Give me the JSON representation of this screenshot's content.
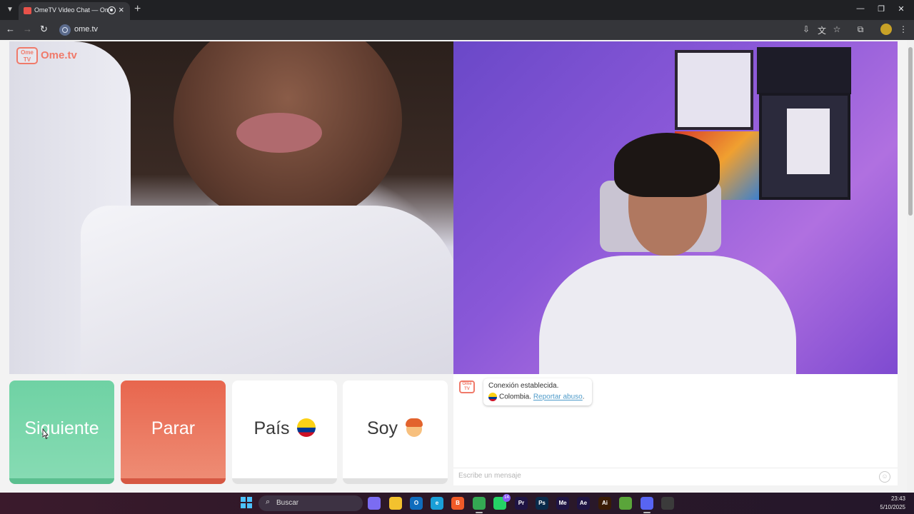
{
  "browser": {
    "tab_title": "OmeTV Video Chat — Ome",
    "url": "ome.tv"
  },
  "logo": {
    "box_text": "Ome\nTV",
    "text": "Ome.tv"
  },
  "buttons": {
    "next": "Siguiente",
    "stop": "Parar",
    "country": "País",
    "gender": "Soy"
  },
  "chat": {
    "logo_text": "Ome TV",
    "message_1": "Conexión establecida.",
    "country": "Colombia.",
    "report_link": "Reportar abuso",
    "report_suffix": ".",
    "input_placeholder": "Escribe un mensaje"
  },
  "taskbar": {
    "search_label": "Buscar",
    "whatsapp_badge": "14",
    "time": "23:43",
    "date": "5/10/2025",
    "apps": [
      {
        "name": "copilot-icon",
        "label": "",
        "color": "#7b6cf2"
      },
      {
        "name": "folder-icon",
        "label": "",
        "color": "#f3c22e"
      },
      {
        "name": "outlook-icon",
        "label": "O",
        "color": "#0f6cbd"
      },
      {
        "name": "edge-icon",
        "label": "e",
        "color": "#1a9fd8"
      },
      {
        "name": "brave-icon",
        "label": "B",
        "color": "#f05a28"
      },
      {
        "name": "chrome-icon",
        "label": "",
        "color": "#34a853"
      },
      {
        "name": "whatsapp-icon",
        "label": "",
        "color": "#25d366"
      },
      {
        "name": "premiere-icon",
        "label": "Pr",
        "color": "#1f1443"
      },
      {
        "name": "photoshop-icon",
        "label": "Ps",
        "color": "#0a2a4a"
      },
      {
        "name": "media-encoder-icon",
        "label": "Me",
        "color": "#1f1443"
      },
      {
        "name": "after-effects-icon",
        "label": "Ae",
        "color": "#1f1443"
      },
      {
        "name": "illustrator-icon",
        "label": "Ai",
        "color": "#3a1c05"
      },
      {
        "name": "minecraft-icon",
        "label": "",
        "color": "#5aa53a"
      },
      {
        "name": "discord-icon",
        "label": "",
        "color": "#5865f2"
      },
      {
        "name": "obs-icon",
        "label": "",
        "color": "#3b3b3b"
      }
    ]
  }
}
